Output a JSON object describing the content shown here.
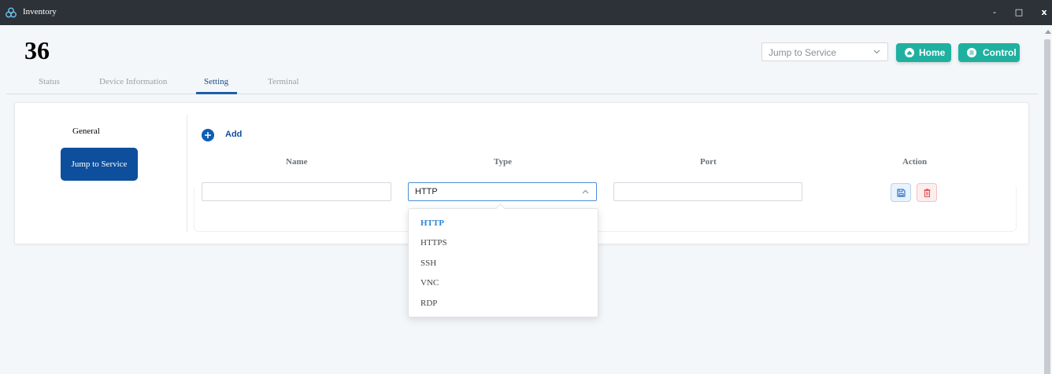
{
  "window": {
    "title": "Inventory",
    "minimize": "-",
    "maximize": "□",
    "close": "x"
  },
  "header": {
    "page_title": "36",
    "jump_select_placeholder": "Jump to Service",
    "home_label": "Home",
    "control_label": "Control",
    "accent_color": "#1fb0a0"
  },
  "tabs": [
    {
      "label": "Status",
      "active": false
    },
    {
      "label": "Device Information",
      "active": false
    },
    {
      "label": "Setting",
      "active": true
    },
    {
      "label": "Terminal",
      "active": false
    }
  ],
  "sidebar": {
    "items": [
      {
        "label": "General",
        "active": false
      },
      {
        "label": "Jump to Service",
        "active": true
      }
    ],
    "active_color": "#0d4f9c"
  },
  "service_table": {
    "add_label": "Add",
    "columns": [
      "Name",
      "Type",
      "Port",
      "Action"
    ],
    "row": {
      "name": "",
      "type": "HTTP",
      "port": ""
    },
    "actions": [
      "save-icon",
      "delete-icon"
    ]
  },
  "type_dropdown": {
    "selected": "HTTP",
    "options": [
      "HTTP",
      "HTTPS",
      "SSH",
      "VNC",
      "RDP"
    ]
  }
}
